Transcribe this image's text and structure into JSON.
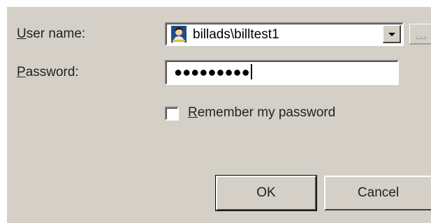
{
  "username": {
    "label_accel": "U",
    "label_rest": "ser name:",
    "value": "billads\\billtest1",
    "icon": "user-icon",
    "browse_label": "..."
  },
  "password": {
    "label_accel": "P",
    "label_rest": "assword:",
    "masked_value": "●●●●●●●●●"
  },
  "remember": {
    "label_accel": "R",
    "label_rest": "emember my password",
    "checked": false
  },
  "buttons": {
    "ok": "OK",
    "cancel": "Cancel"
  },
  "colors": {
    "dialog_background": "#d4d0c8"
  }
}
